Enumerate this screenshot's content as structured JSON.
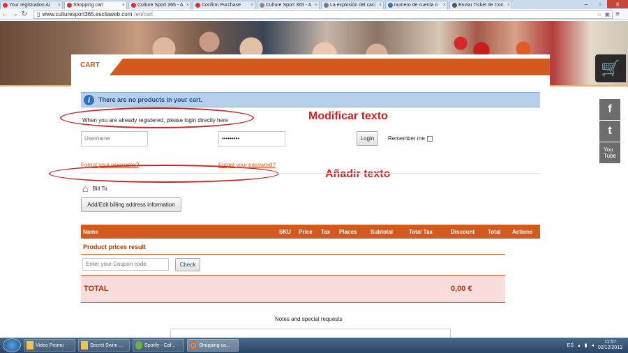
{
  "browser": {
    "tabs": [
      {
        "label": "Your registration Al",
        "color": "#d33"
      },
      {
        "label": "Shopping cart",
        "color": "#c33",
        "active": true
      },
      {
        "label": "Culture Sport 365 - A",
        "color": "#c33"
      },
      {
        "label": "Confirm Purchase",
        "color": "#c33"
      },
      {
        "label": "Culture Sport 365 - A",
        "color": "#888"
      },
      {
        "label": "La explosión del caci",
        "color": "#777"
      },
      {
        "label": "numero de cuenta o",
        "color": "#3a6fb0"
      },
      {
        "label": "Enviar Ticket de Con",
        "color": "#555"
      }
    ],
    "url_host": "www.culturesport365.escilaweb.com",
    "url_path": "/en/cart"
  },
  "page": {
    "cart_title": "CART",
    "notice": "There are no products in your cart.",
    "login_message": "When you are already registered, please login directly here",
    "username_placeholder": "Username",
    "password_value": "•••••••••",
    "login_button": "Login",
    "remember_me": "Remember me",
    "forgot_username": "Forgot your username?",
    "forgot_password": "Forgot your password?",
    "bill_to": "Bill To",
    "billing_button": "Add/Edit billing address information",
    "table_headers": [
      "Name",
      "SKU",
      "Price",
      "Tax",
      "Places",
      "Subtotal",
      "Total Tax",
      "Discount",
      "Total",
      "Actions"
    ],
    "product_prices_result": "Product prices result",
    "coupon_placeholder": "Enter your Coupon code",
    "check_button": "Check",
    "total_label": "TOTAL",
    "total_value": "0,00 €",
    "notes_label": "Notes and special requests"
  },
  "annotations": {
    "modify": "Modificar texto",
    "add": "Añadir texto",
    "color": "#d32020"
  },
  "taskbar": {
    "items": [
      "Video Promo",
      "Secret Swim ...",
      "Spotify - Caf...",
      "Shopping ca..."
    ],
    "lang": "ES",
    "time": "11:57",
    "date": "02/12/2013"
  }
}
